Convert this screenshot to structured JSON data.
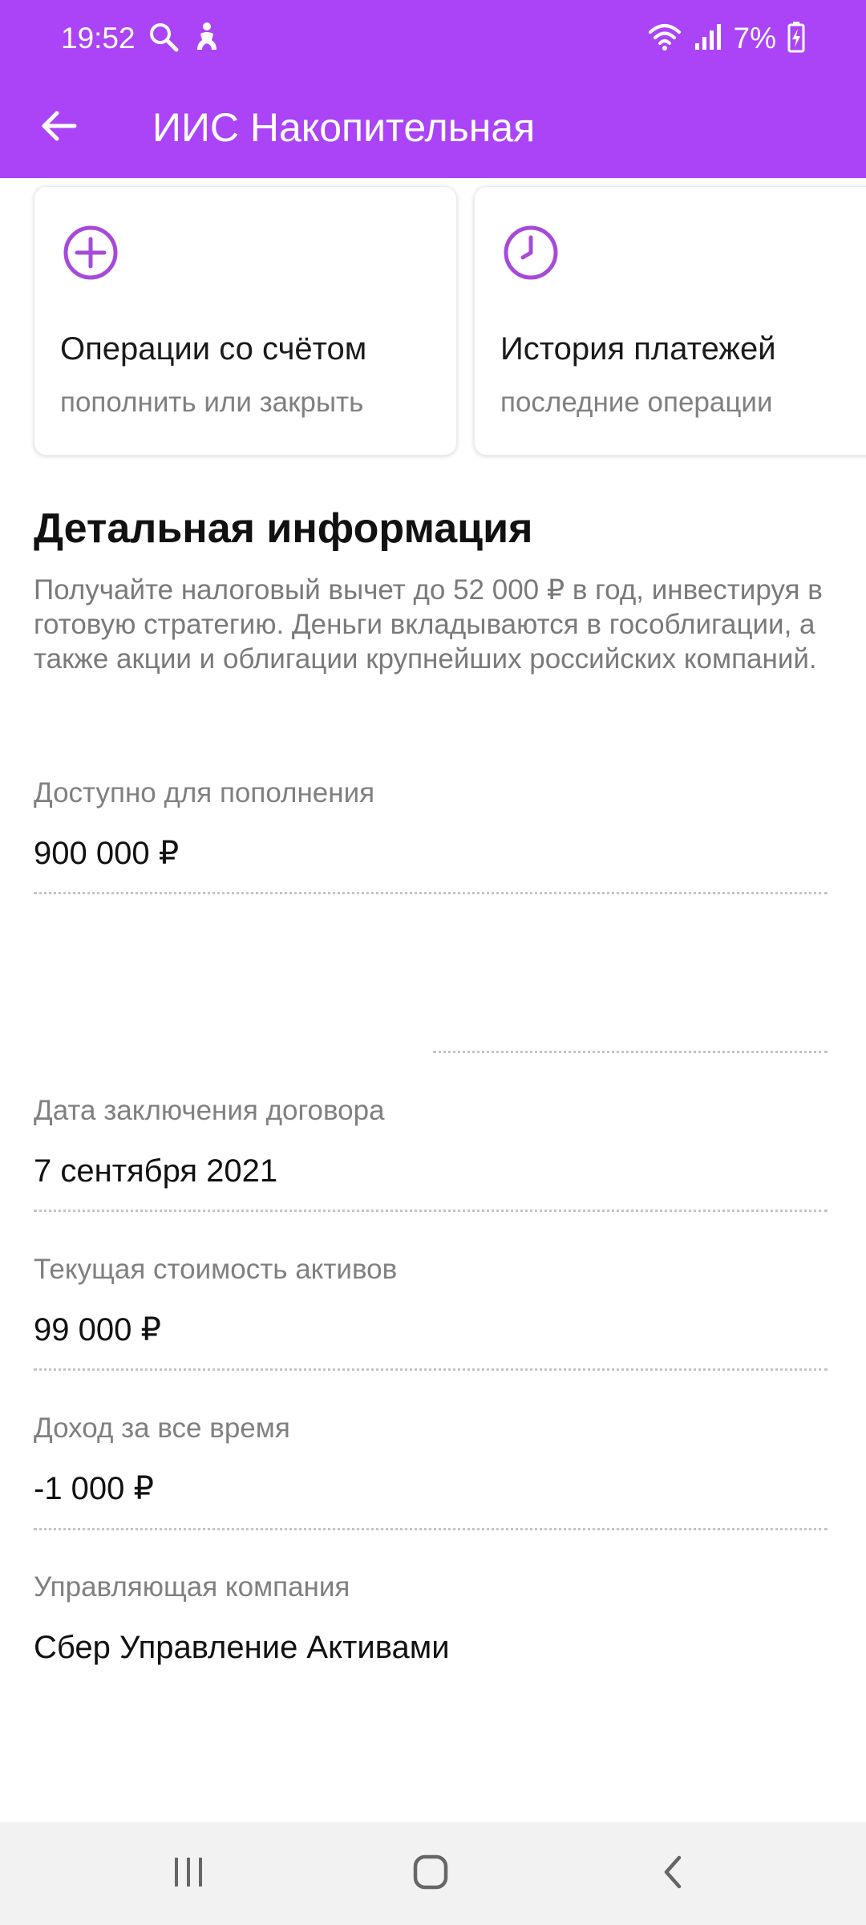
{
  "status_bar": {
    "time": "19:52",
    "battery": "7%",
    "icons": [
      "search-icon",
      "accessibility-icon",
      "wifi-icon",
      "signal-icon",
      "battery-charging-icon"
    ]
  },
  "header": {
    "title": "ИИС Накопительная",
    "back_icon": "arrow-left-icon",
    "background_color": "#ab44f7"
  },
  "cards": [
    {
      "icon": "plus-circle-icon",
      "title": "Операции со счётом",
      "subtitle": "пополнить или закрыть"
    },
    {
      "icon": "clock-icon",
      "title": "История платежей",
      "subtitle": "последние операции"
    }
  ],
  "details": {
    "title": "Детальная информация",
    "description": "Получайте налоговый вычет до 52 000 ₽ в год, инвестируя в готовую стратегию. Деньги вкладываются в гособлигации, а также акции и облигации крупнейших российских компаний.",
    "fields": [
      {
        "label": "Доступно для пополнения",
        "value": "900 000 ₽"
      },
      {
        "label": "Дата заключения договора",
        "value": "7 сентября 2021"
      },
      {
        "label": "Текущая стоимость активов",
        "value": "99 000 ₽"
      },
      {
        "label": "Доход за все время",
        "value": "-1 000 ₽"
      },
      {
        "label": "Управляющая компания",
        "value": "Сбер Управление Активами"
      }
    ]
  },
  "accent_color": "#a64bd8",
  "nav_bar": {
    "icons": [
      "recents-icon",
      "home-icon",
      "back-icon"
    ]
  }
}
